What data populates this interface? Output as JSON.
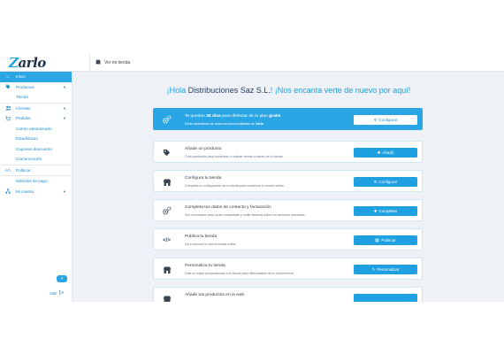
{
  "topbar": {
    "logo_text": "Zarlo",
    "store_link": "Ver mi tienda"
  },
  "sidebar": {
    "items": [
      {
        "label": "Inicio",
        "icon": "home-icon",
        "glyph": "⌂"
      },
      {
        "label": "Productos",
        "icon": "tag-icon",
        "glyph": "▪"
      },
      {
        "label": "Tienda",
        "icon": "",
        "glyph": ""
      },
      {
        "label": "Clientes",
        "icon": "users-icon",
        "glyph": "👥"
      },
      {
        "label": "Pedidos",
        "icon": "cart-icon",
        "glyph": "▦"
      },
      {
        "label": "Carrito abandonado",
        "icon": "",
        "glyph": ""
      },
      {
        "label": "Estadísticas",
        "icon": "",
        "glyph": ""
      },
      {
        "label": "Cupones descuento",
        "icon": "",
        "glyph": ""
      },
      {
        "label": "Comunicación",
        "icon": "",
        "glyph": ""
      },
      {
        "label": "Publicar",
        "icon": "code-icon",
        "glyph": "</>"
      },
      {
        "label": "Métodos de pago",
        "icon": "",
        "glyph": ""
      },
      {
        "label": "Mi cuenta",
        "icon": "sitemap-icon",
        "glyph": "⊞"
      }
    ],
    "collapse_glyph": "«",
    "logout_label": "Salir"
  },
  "main": {
    "welcome_pre": "¡Hola ",
    "welcome_company": "Distribuciones Saz S.L.",
    "welcome_post": "! ¡Nos encanta verte de nuevo por aquí!",
    "cards": [
      {
        "title_pre": "Te quedan ",
        "title_bold": "28 días",
        "title_mid": " para disfrutar de tu plan ",
        "title_bold2": "gratis",
        "desc_pre": "Estas disfrutando de todas las funcionalidades de ",
        "desc_bold": "Zarlo",
        "desc_post": ".",
        "button": "Configurar",
        "button_icon": "gears-icon",
        "icon": "gears-icon"
      },
      {
        "title": "Añade un producto",
        "desc": "Crea productos para comenzar a realizar ventas a través de tu tienda.",
        "button": "Añadir",
        "button_icon": "plus-icon",
        "icon": "tag-icon"
      },
      {
        "title": "Configura tu tienda",
        "desc": "Completa la configuración de tu tienda para comenzar a vender online.",
        "button": "Configurar",
        "button_icon": "gears-icon",
        "icon": "store-icon"
      },
      {
        "title": "Completa tus datos de contacto y facturación",
        "desc": "Son necesarios para poder contactarte y emitir facturas sobre los servicios prestados.",
        "button": "Completar",
        "button_icon": "plus-icon",
        "icon": "gears-icon"
      },
      {
        "title": "Publica tu tienda",
        "desc": "Da a conocer tu nueva tienda online.",
        "button": "Publicar",
        "button_icon": "globe-icon",
        "icon": "code-icon"
      },
      {
        "title": "Personaliza tu tienda",
        "desc": "Dale un toque personalizado a tu tienda para diferenciarte de tu competencia.",
        "button": "Personalizar",
        "button_icon": "pencil-icon",
        "icon": "store-icon"
      },
      {
        "title": "Añade tus productos en la web",
        "desc": "",
        "button": "",
        "button_icon": "",
        "icon": "store-icon"
      }
    ]
  },
  "colors": {
    "accent": "#29a6e3",
    "heading": "#1aa0dc",
    "company": "#1d3b5e",
    "background": "#eef1f5"
  }
}
